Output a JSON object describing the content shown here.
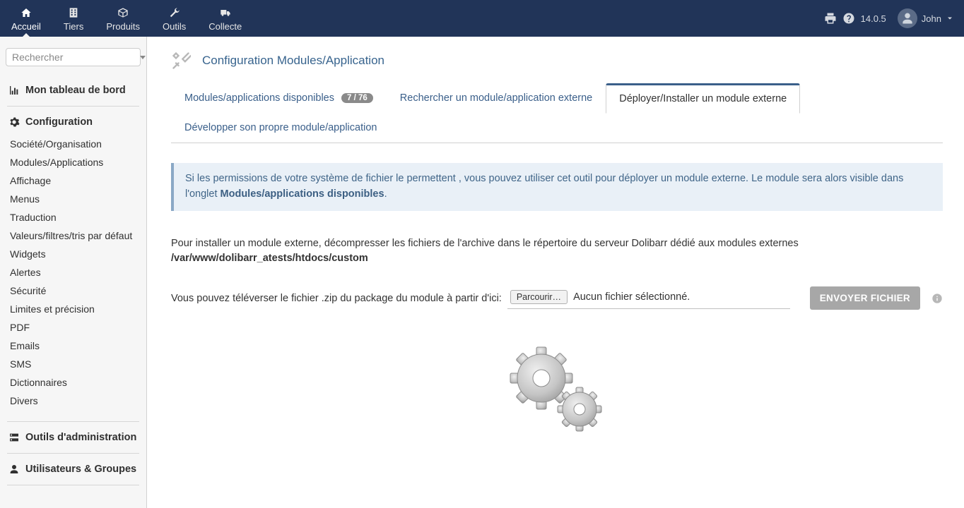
{
  "topnav": {
    "items": [
      {
        "label": "Accueil",
        "icon": "home-icon",
        "active": true
      },
      {
        "label": "Tiers",
        "icon": "building-icon"
      },
      {
        "label": "Produits",
        "icon": "cube-icon"
      },
      {
        "label": "Outils",
        "icon": "wrench-icon"
      },
      {
        "label": "Collecte",
        "icon": "truck-icon"
      }
    ],
    "version": "14.0.5",
    "user_name": "John"
  },
  "sidebar": {
    "search_placeholder": "Rechercher",
    "dashboard_heading": "Mon tableau de bord",
    "config_heading": "Configuration",
    "config_items": [
      {
        "label": "Société/Organisation"
      },
      {
        "label": "Modules/Applications"
      },
      {
        "label": "Affichage"
      },
      {
        "label": "Menus"
      },
      {
        "label": "Traduction"
      },
      {
        "label": "Valeurs/filtres/tris par défaut"
      },
      {
        "label": "Widgets"
      },
      {
        "label": "Alertes"
      },
      {
        "label": "Sécurité"
      },
      {
        "label": "Limites et précision"
      },
      {
        "label": "PDF"
      },
      {
        "label": "Emails"
      },
      {
        "label": "SMS"
      },
      {
        "label": "Dictionnaires"
      },
      {
        "label": "Divers"
      }
    ],
    "admin_tools_heading": "Outils d'administration",
    "users_heading": "Utilisateurs & Groupes"
  },
  "page": {
    "title": "Configuration Modules/Application",
    "tabs": [
      {
        "label": "Modules/applications disponibles",
        "badge": "7 / 76"
      },
      {
        "label": "Rechercher un module/application externe"
      },
      {
        "label": "Déployer/Installer un module externe",
        "active": true
      },
      {
        "label": "Développer son propre module/application"
      }
    ],
    "infobox": {
      "text_before": "Si les permissions de votre système de fichier le permettent , vous pouvez utiliser cet outil pour déployer un module externe. Le module sera alors visible dans l'onglet ",
      "strong": "Modules/applications disponibles",
      "text_after": "."
    },
    "instruction": {
      "line1": "Pour installer un module externe, décompresser les fichiers de l'archive dans le répertoire du serveur Dolibarr dédié aux modules externes",
      "path": "/var/www/dolibarr_atests/htdocs/custom"
    },
    "upload": {
      "label": "Vous pouvez téléverser le fichier .zip du package du module à partir d'ici:",
      "browse_button": "Parcourir…",
      "no_file": "Aucun fichier sélectionné.",
      "submit": "ENVOYER FICHIER"
    }
  },
  "colors": {
    "accent": "#213458",
    "link": "#38648e",
    "info_bg": "#e9f0f7"
  }
}
